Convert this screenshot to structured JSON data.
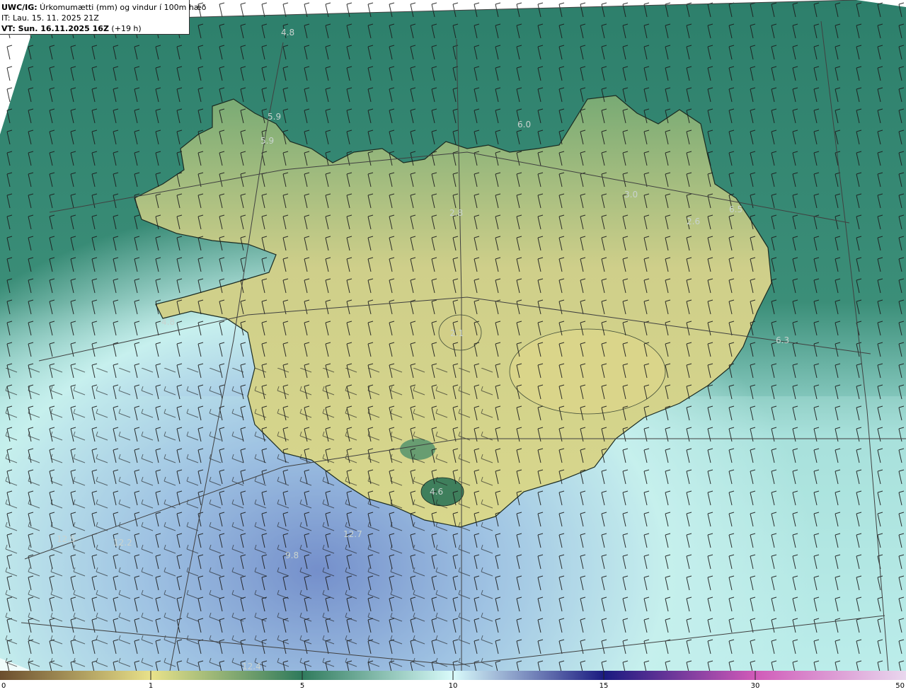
{
  "header": {
    "line1_bold": "UWC/IG:",
    "line1_rest": " Úrkomumætti (mm) og vindur í 100m hæð",
    "line2": "IT: Lau. 15. 11. 2025 21Z",
    "line3_bold": "VT: Sun. 16.11.2025 16Z",
    "line3_rest": " (+19 h)"
  },
  "map_labels": [
    "4.8",
    "5.9",
    "5.9",
    "6.0",
    "3.0",
    "2.8",
    "2.6",
    "6.5",
    "4.8",
    "2.1",
    "6.3",
    "4.6",
    "12.7",
    "12.2",
    "9.8",
    "12.4",
    "12.5"
  ],
  "colorbar": {
    "ticks": [
      "0",
      "1",
      "5",
      "10",
      "15",
      "30",
      "50"
    ],
    "stops": [
      "#6b4e2e",
      "#e9e28a",
      "#2f7a5c",
      "#d9fbfb",
      "#1a1a80",
      "#d05ab8",
      "#e9d7ee"
    ]
  },
  "colors": {
    "ocean_north": "#2d7f6b",
    "ocean_east": "#3a8f7a",
    "ocean_south": "#aee5e2",
    "precip_heavy": "#5a6fc0",
    "land_low": "#3f8d68",
    "land_high": "#d8d78c",
    "coast": "#1b2b22",
    "barb": "#1a1a1a",
    "grid": "#404040"
  }
}
